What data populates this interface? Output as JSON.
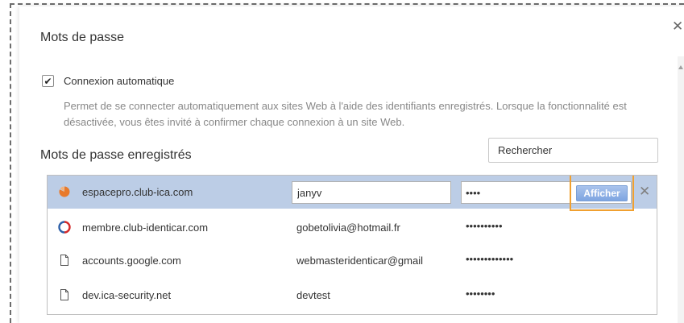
{
  "dialog": {
    "title": "Mots de passe",
    "close_icon": "close-icon",
    "autosignin": {
      "checked": true,
      "label": "Connexion automatique",
      "description": "Permet de se connecter automatiquement aux sites Web à l'aide des identifiants enregistrés. Lorsque la fonctionnalité est désactivée, vous êtes invité à confirmer chaque connexion à un site Web."
    },
    "saved_title": "Mots de passe enregistrés",
    "search": {
      "placeholder": "Rechercher"
    },
    "show_label": "Afficher",
    "colors": {
      "selected_row": "#bccde6",
      "highlight": "#f0a030",
      "show_button": "#8fb0e4"
    },
    "rows": [
      {
        "icon": "orange-site-icon",
        "site": "espacepro.club-ica.com",
        "username": "janyv",
        "password": "••••",
        "selected": true
      },
      {
        "icon": "club-identicar-icon",
        "site": "membre.club-identicar.com",
        "username": "gobetolivia@hotmail.fr",
        "password": "••••••••••"
      },
      {
        "icon": "page-icon",
        "site": "accounts.google.com",
        "username": "webmasteridenticar@gmail",
        "password": "•••••••••••••"
      },
      {
        "icon": "page-icon",
        "site": "dev.ica-security.net",
        "username": "devtest",
        "password": "••••••••"
      }
    ]
  }
}
